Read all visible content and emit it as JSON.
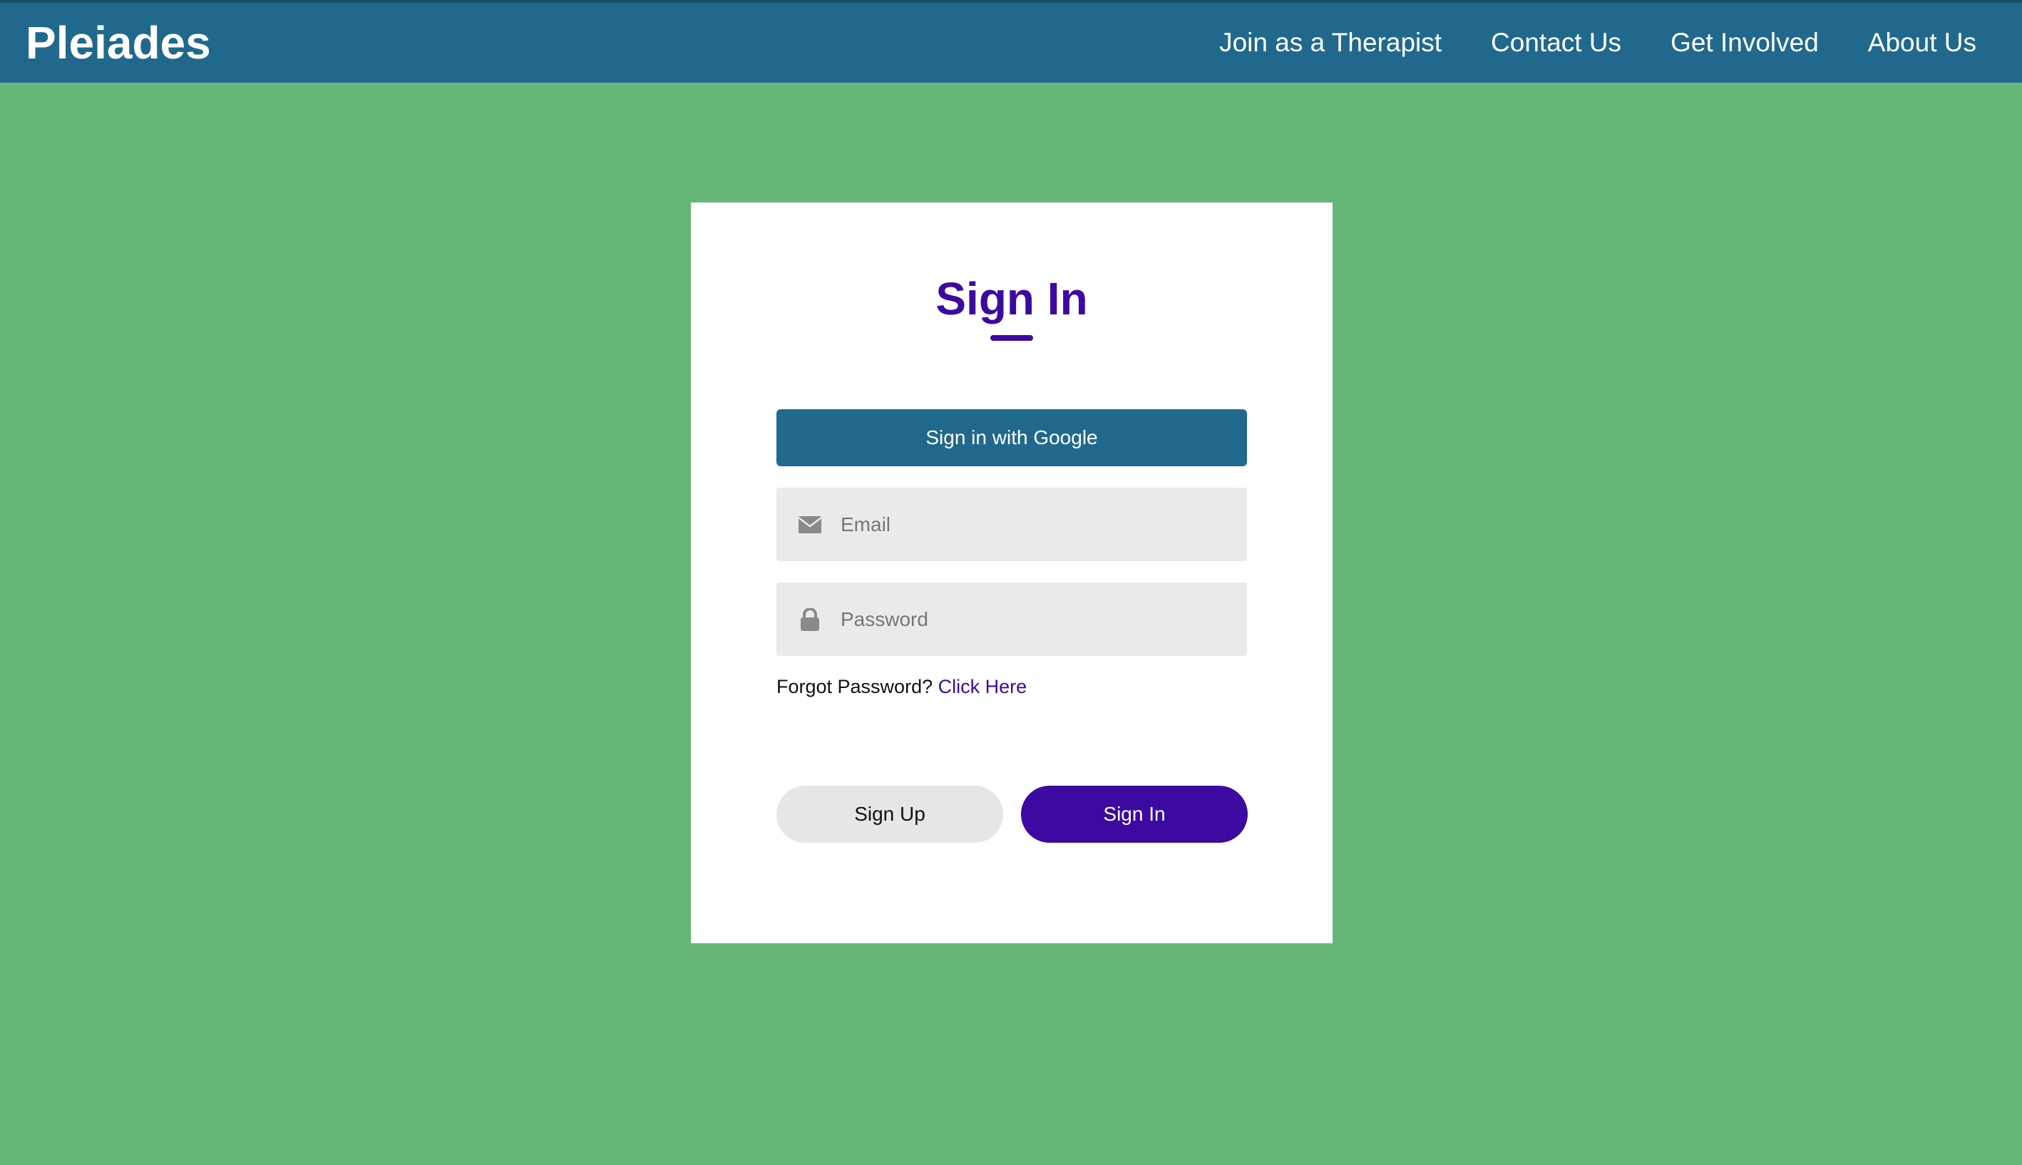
{
  "navbar": {
    "brand": "Pleiades",
    "links": [
      "Join as a Therapist",
      "Contact Us",
      "Get Involved",
      "About Us"
    ]
  },
  "signin_card": {
    "title": "Sign In",
    "google_button": "Sign in with Google",
    "email": {
      "placeholder": "Email",
      "value": "",
      "icon": "envelope-icon"
    },
    "password": {
      "placeholder": "Password",
      "value": "",
      "icon": "lock-icon"
    },
    "forgot_text": "Forgot Password?",
    "forgot_link": "Click Here",
    "signup_button": "Sign Up",
    "signin_button": "Sign In"
  },
  "colors": {
    "background": "#66b777",
    "navbar": "#21698c",
    "accent": "#3c0aa0",
    "field": "#eaeaea"
  }
}
